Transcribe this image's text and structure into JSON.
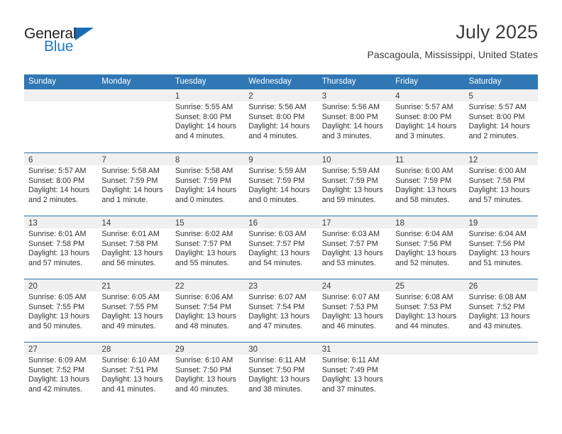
{
  "brand": {
    "name_part1": "General",
    "name_part2": "Blue",
    "flag_icon": "triangle-flag-icon"
  },
  "header": {
    "month_title": "July 2025",
    "location": "Pascagoula, Mississippi, United States"
  },
  "theme": {
    "header_blue": "#3077b4",
    "row_divider_blue": "#2a6ca8",
    "daynum_band": "#f0f0f0",
    "brand_blue": "#1f7ac0",
    "text": "#303030"
  },
  "calendar": {
    "weekdays": [
      "Sunday",
      "Monday",
      "Tuesday",
      "Wednesday",
      "Thursday",
      "Friday",
      "Saturday"
    ],
    "weeks": [
      [
        {
          "day": "",
          "lines": []
        },
        {
          "day": "",
          "lines": []
        },
        {
          "day": "1",
          "lines": [
            "Sunrise: 5:55 AM",
            "Sunset: 8:00 PM",
            "Daylight: 14 hours and 4 minutes."
          ]
        },
        {
          "day": "2",
          "lines": [
            "Sunrise: 5:56 AM",
            "Sunset: 8:00 PM",
            "Daylight: 14 hours and 4 minutes."
          ]
        },
        {
          "day": "3",
          "lines": [
            "Sunrise: 5:56 AM",
            "Sunset: 8:00 PM",
            "Daylight: 14 hours and 3 minutes."
          ]
        },
        {
          "day": "4",
          "lines": [
            "Sunrise: 5:57 AM",
            "Sunset: 8:00 PM",
            "Daylight: 14 hours and 3 minutes."
          ]
        },
        {
          "day": "5",
          "lines": [
            "Sunrise: 5:57 AM",
            "Sunset: 8:00 PM",
            "Daylight: 14 hours and 2 minutes."
          ]
        }
      ],
      [
        {
          "day": "6",
          "lines": [
            "Sunrise: 5:57 AM",
            "Sunset: 8:00 PM",
            "Daylight: 14 hours and 2 minutes."
          ]
        },
        {
          "day": "7",
          "lines": [
            "Sunrise: 5:58 AM",
            "Sunset: 7:59 PM",
            "Daylight: 14 hours and 1 minute."
          ]
        },
        {
          "day": "8",
          "lines": [
            "Sunrise: 5:58 AM",
            "Sunset: 7:59 PM",
            "Daylight: 14 hours and 0 minutes."
          ]
        },
        {
          "day": "9",
          "lines": [
            "Sunrise: 5:59 AM",
            "Sunset: 7:59 PM",
            "Daylight: 14 hours and 0 minutes."
          ]
        },
        {
          "day": "10",
          "lines": [
            "Sunrise: 5:59 AM",
            "Sunset: 7:59 PM",
            "Daylight: 13 hours and 59 minutes."
          ]
        },
        {
          "day": "11",
          "lines": [
            "Sunrise: 6:00 AM",
            "Sunset: 7:59 PM",
            "Daylight: 13 hours and 58 minutes."
          ]
        },
        {
          "day": "12",
          "lines": [
            "Sunrise: 6:00 AM",
            "Sunset: 7:58 PM",
            "Daylight: 13 hours and 57 minutes."
          ]
        }
      ],
      [
        {
          "day": "13",
          "lines": [
            "Sunrise: 6:01 AM",
            "Sunset: 7:58 PM",
            "Daylight: 13 hours and 57 minutes."
          ]
        },
        {
          "day": "14",
          "lines": [
            "Sunrise: 6:01 AM",
            "Sunset: 7:58 PM",
            "Daylight: 13 hours and 56 minutes."
          ]
        },
        {
          "day": "15",
          "lines": [
            "Sunrise: 6:02 AM",
            "Sunset: 7:57 PM",
            "Daylight: 13 hours and 55 minutes."
          ]
        },
        {
          "day": "16",
          "lines": [
            "Sunrise: 6:03 AM",
            "Sunset: 7:57 PM",
            "Daylight: 13 hours and 54 minutes."
          ]
        },
        {
          "day": "17",
          "lines": [
            "Sunrise: 6:03 AM",
            "Sunset: 7:57 PM",
            "Daylight: 13 hours and 53 minutes."
          ]
        },
        {
          "day": "18",
          "lines": [
            "Sunrise: 6:04 AM",
            "Sunset: 7:56 PM",
            "Daylight: 13 hours and 52 minutes."
          ]
        },
        {
          "day": "19",
          "lines": [
            "Sunrise: 6:04 AM",
            "Sunset: 7:56 PM",
            "Daylight: 13 hours and 51 minutes."
          ]
        }
      ],
      [
        {
          "day": "20",
          "lines": [
            "Sunrise: 6:05 AM",
            "Sunset: 7:55 PM",
            "Daylight: 13 hours and 50 minutes."
          ]
        },
        {
          "day": "21",
          "lines": [
            "Sunrise: 6:05 AM",
            "Sunset: 7:55 PM",
            "Daylight: 13 hours and 49 minutes."
          ]
        },
        {
          "day": "22",
          "lines": [
            "Sunrise: 6:06 AM",
            "Sunset: 7:54 PM",
            "Daylight: 13 hours and 48 minutes."
          ]
        },
        {
          "day": "23",
          "lines": [
            "Sunrise: 6:07 AM",
            "Sunset: 7:54 PM",
            "Daylight: 13 hours and 47 minutes."
          ]
        },
        {
          "day": "24",
          "lines": [
            "Sunrise: 6:07 AM",
            "Sunset: 7:53 PM",
            "Daylight: 13 hours and 46 minutes."
          ]
        },
        {
          "day": "25",
          "lines": [
            "Sunrise: 6:08 AM",
            "Sunset: 7:53 PM",
            "Daylight: 13 hours and 44 minutes."
          ]
        },
        {
          "day": "26",
          "lines": [
            "Sunrise: 6:08 AM",
            "Sunset: 7:52 PM",
            "Daylight: 13 hours and 43 minutes."
          ]
        }
      ],
      [
        {
          "day": "27",
          "lines": [
            "Sunrise: 6:09 AM",
            "Sunset: 7:52 PM",
            "Daylight: 13 hours and 42 minutes."
          ]
        },
        {
          "day": "28",
          "lines": [
            "Sunrise: 6:10 AM",
            "Sunset: 7:51 PM",
            "Daylight: 13 hours and 41 minutes."
          ]
        },
        {
          "day": "29",
          "lines": [
            "Sunrise: 6:10 AM",
            "Sunset: 7:50 PM",
            "Daylight: 13 hours and 40 minutes."
          ]
        },
        {
          "day": "30",
          "lines": [
            "Sunrise: 6:11 AM",
            "Sunset: 7:50 PM",
            "Daylight: 13 hours and 38 minutes."
          ]
        },
        {
          "day": "31",
          "lines": [
            "Sunrise: 6:11 AM",
            "Sunset: 7:49 PM",
            "Daylight: 13 hours and 37 minutes."
          ]
        },
        {
          "day": "",
          "lines": []
        },
        {
          "day": "",
          "lines": []
        }
      ]
    ]
  }
}
